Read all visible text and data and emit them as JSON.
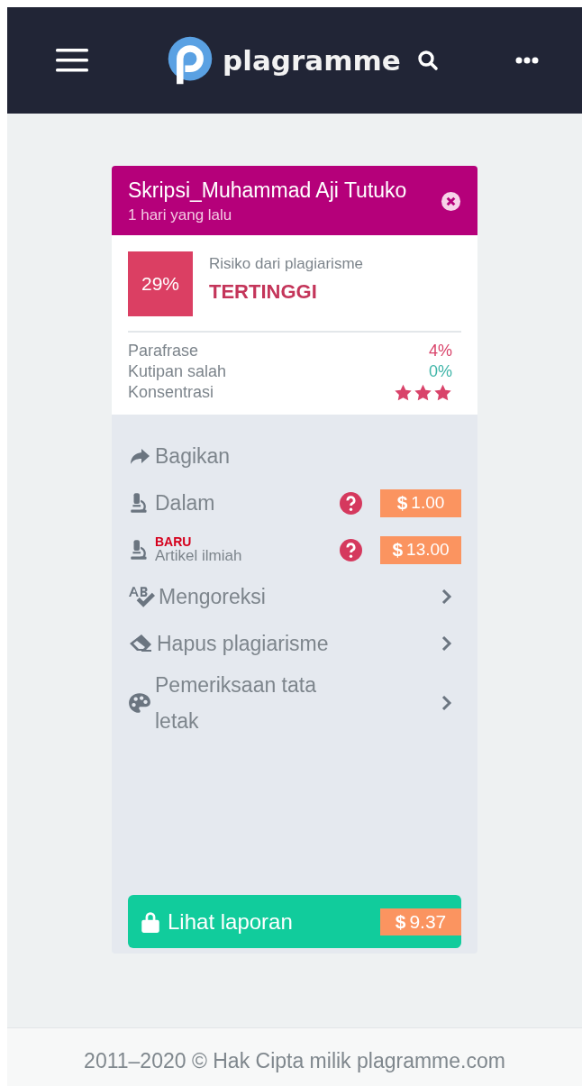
{
  "navbar": {
    "brand": "plagramme"
  },
  "card": {
    "title": "Skripsi_Muhammad Aji Tutuko",
    "time": "1 hari yang lalu",
    "risk": {
      "percent": "29%",
      "label": "Risiko dari plagiarisme",
      "level_text": "TERTINGGI"
    },
    "metrics": [
      {
        "kind": "text",
        "label": "Parafrase",
        "value": "4%",
        "color": "#d9436a"
      },
      {
        "kind": "text",
        "label": "Kutipan salah",
        "value": "0%",
        "color": "#3fb5a8"
      },
      {
        "kind": "stars",
        "label": "Konsentrasi",
        "stars": 3
      }
    ],
    "actions": [
      {
        "kind": "plain",
        "label": "Bagikan"
      },
      {
        "kind": "price",
        "label": "Dalam",
        "currency": "$",
        "amount": "1.00"
      },
      {
        "kind": "price",
        "label": "Artikel ilmiah",
        "badge": "BARU",
        "currency": "$",
        "amount": "13.00"
      },
      {
        "kind": "chevron",
        "label": "Mengoreksi"
      },
      {
        "kind": "chevron",
        "label": "Hapus plagiarisme"
      },
      {
        "kind": "chevron",
        "label": "Pemeriksaan tata letak"
      }
    ],
    "report_button": {
      "label": "Lihat laporan",
      "currency": "$",
      "amount": "9.37"
    }
  },
  "footer": "2011–2020 © Hak Cipta milik plagramme.com"
}
